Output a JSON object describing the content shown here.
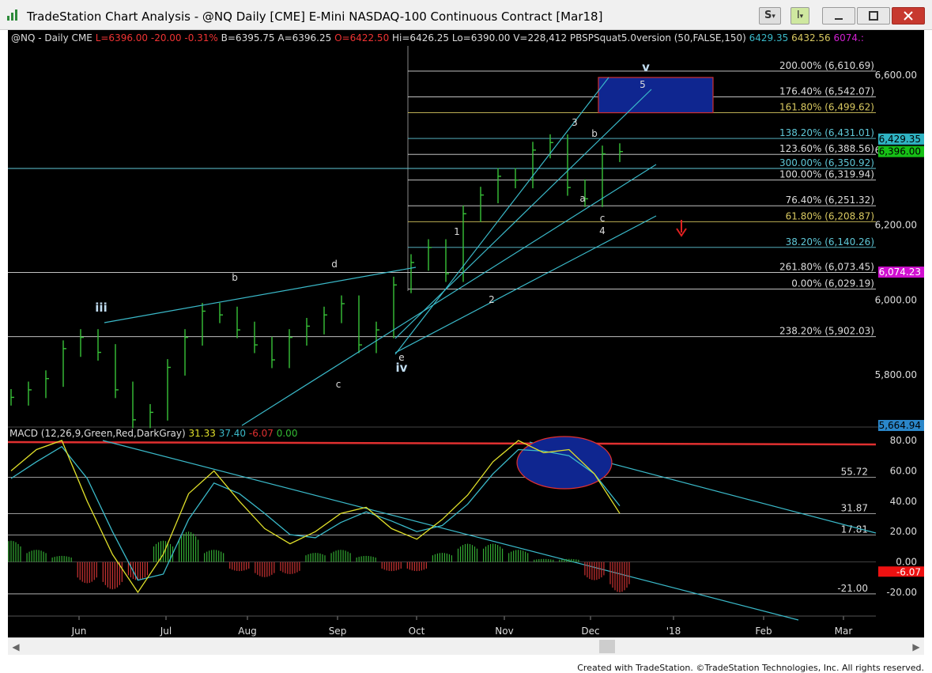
{
  "window": {
    "title": "TradeStation Chart Analysis - @NQ Daily [CME] E-Mini NASDAQ-100 Continuous Contract [Mar18]",
    "btn_s": "S",
    "btn_i": "I",
    "caret": "▾"
  },
  "footer": "Created with TradeStation. ©TradeStation Technologies, Inc. All rights reserved.",
  "price_header": {
    "symbol": "@NQ - Daily  CME",
    "low": "L=6396.00",
    "chg": "-20.00",
    "pct": "-0.31%",
    "bid": "B=6395.75",
    "ask": "A=6396.25",
    "open": "O=6422.50",
    "hilo": "Hi=6426.25  Lo=6390.00",
    "vol": "V=228,412",
    "study": "PBSPSquat5.0version (50,FALSE,150)",
    "v1": "6429.35",
    "v2": "6432.56",
    "v3": "6074.:"
  },
  "macd_header": {
    "label": "MACD (12,26,9,Green,Red,DarkGray)",
    "v1": "31.33",
    "v2": "37.40",
    "v3": "-6.07",
    "v4": "0.00"
  },
  "colors": {
    "bg": "#000000",
    "bars": "#38c238",
    "trend": "#3ab9c9",
    "fib": "#b0d8e0",
    "ycol": "#e0e02a",
    "mred": "#e03030",
    "hist_pos": "#33aa33",
    "hist_neg": "#cc3333",
    "box": "#0f2690"
  },
  "chart_data": [
    {
      "type": "bar",
      "name": "price",
      "title": "@NQ - Daily",
      "x_labels": [
        "Jun",
        "Jul",
        "Aug",
        "Sep",
        "Oct",
        "Nov",
        "Dec",
        "'18",
        "Feb",
        "Mar"
      ],
      "y_ticks": [
        "6,600.00",
        "6,400.00",
        "6,200.00",
        "6,000.00",
        "5,800.00"
      ],
      "ylim": [
        5664.94,
        6600
      ],
      "last_close": "6,396.00",
      "tags": [
        {
          "text": "6,429.35"
        },
        {
          "text": "6,396.00"
        },
        {
          "text": "6,074.23"
        },
        {
          "text": "5,664.94"
        }
      ],
      "fib_levels": [
        {
          "label": "200.00% (6,610.69)",
          "value": 6610.69,
          "color": "#dddddd"
        },
        {
          "label": "176.40% (6,542.07)",
          "value": 6542.07,
          "color": "#dddddd"
        },
        {
          "label": "161.80% (6,499.62)",
          "value": 6499.62,
          "color": "#d8c860"
        },
        {
          "label": "138.20% (6,431.01)",
          "value": 6431.01,
          "color": "#5fc8d8"
        },
        {
          "label": "123.60% (6,388.56)",
          "value": 6388.56,
          "color": "#dddddd"
        },
        {
          "label": "300.00% (6,350.92)",
          "value": 6350.92,
          "color": "#5fc8d8"
        },
        {
          "label": "100.00% (6,319.94)",
          "value": 6319.94,
          "color": "#dddddd"
        },
        {
          "label": "76.40% (6,251.32)",
          "value": 6251.32,
          "color": "#dddddd"
        },
        {
          "label": "61.80% (6,208.87)",
          "value": 6208.87,
          "color": "#d8c860"
        },
        {
          "label": "38.20% (6,140.26)",
          "value": 6140.26,
          "color": "#5fc8d8"
        },
        {
          "label": "261.80% (6,073.45)",
          "value": 6073.45,
          "color": "#dddddd"
        },
        {
          "label": "0.00% (6,029.19)",
          "value": 6029.19,
          "color": "#dddddd"
        },
        {
          "label": "238.20% (5,902.03)",
          "value": 5902.03,
          "color": "#dddddd"
        }
      ],
      "wave_labels": [
        "iii",
        "b",
        "c",
        "d",
        "e",
        "iv",
        "1",
        "2",
        "3",
        "a",
        "b",
        "c",
        "4",
        "5",
        "v"
      ],
      "target_box": {
        "from": 6499.62,
        "to": 6610.69
      },
      "closes_sample": [
        5740,
        5760,
        5790,
        5870,
        5900,
        5860,
        5760,
        5680,
        5700,
        5820,
        5900,
        5970,
        5960,
        5920,
        5880,
        5840,
        5900,
        5930,
        5960,
        5990,
        5880,
        5920,
        6040,
        6100,
        6140,
        6070,
        6230,
        6280,
        6330,
        6320,
        6400,
        6420,
        6300,
        6270,
        6390,
        6396
      ]
    },
    {
      "type": "line",
      "name": "MACD",
      "y_ticks": [
        "80.00",
        "60.00",
        "40.00",
        "20.00",
        "0.00",
        "-20.00"
      ],
      "ylim": [
        -28,
        83
      ],
      "levels": [
        {
          "label": "55.72",
          "value": 55.72
        },
        {
          "label": "31.87",
          "value": 31.87
        },
        {
          "label": "17.81",
          "value": 17.81
        },
        {
          "label": "-21.00",
          "value": -21.0
        }
      ],
      "last_tag": "-6.07",
      "series": [
        {
          "name": "MACD",
          "values": [
            60,
            74,
            80,
            40,
            5,
            -20,
            5,
            45,
            60,
            40,
            22,
            12,
            20,
            32,
            36,
            22,
            15,
            28,
            44,
            66,
            80,
            72,
            74,
            58,
            32
          ]
        },
        {
          "name": "Signal",
          "values": [
            55,
            66,
            76,
            55,
            20,
            -12,
            -8,
            28,
            52,
            45,
            32,
            18,
            16,
            26,
            33,
            27,
            20,
            24,
            38,
            58,
            74,
            73,
            70,
            58,
            37
          ]
        }
      ],
      "histogram": [
        14,
        8,
        4,
        -14,
        -18,
        -12,
        14,
        20,
        8,
        -6,
        -10,
        -8,
        6,
        8,
        4,
        -6,
        -6,
        6,
        12,
        12,
        8,
        2,
        2,
        -12,
        -20
      ]
    }
  ]
}
